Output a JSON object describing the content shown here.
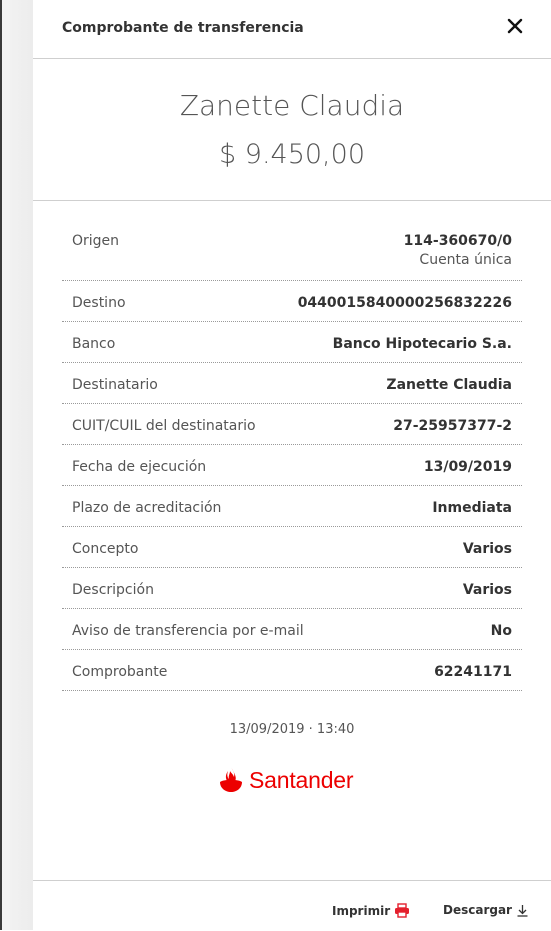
{
  "header": {
    "title": "Comprobante de transferencia"
  },
  "hero": {
    "name": "Zanette Claudia",
    "amount": "$ 9.450,00"
  },
  "details": {
    "origen": {
      "label": "Origen",
      "value": "114-360670/0",
      "sub": "Cuenta única"
    },
    "rows": [
      {
        "label": "Destino",
        "value": "0440015840000256832226"
      },
      {
        "label": "Banco",
        "value": "Banco Hipotecario S.a."
      },
      {
        "label": "Destinatario",
        "value": "Zanette Claudia"
      },
      {
        "label": "CUIT/CUIL del destinatario",
        "value": "27-25957377-2"
      },
      {
        "label": "Fecha de ejecución",
        "value": "13/09/2019"
      },
      {
        "label": "Plazo de acreditación",
        "value": "Inmediata"
      },
      {
        "label": "Concepto",
        "value": "Varios"
      },
      {
        "label": "Descripción",
        "value": "Varios"
      },
      {
        "label": "Aviso de transferencia por e-mail",
        "value": "No"
      },
      {
        "label": "Comprobante",
        "value": "62241171"
      }
    ]
  },
  "timestamp": "13/09/2019 · 13:40",
  "brand": {
    "name": "Santander",
    "color": "#ec0000"
  },
  "footer": {
    "print_label": "Imprimir",
    "download_label": "Descargar"
  },
  "icons": {
    "close": "close-icon",
    "print": "printer-icon",
    "download": "download-icon"
  }
}
